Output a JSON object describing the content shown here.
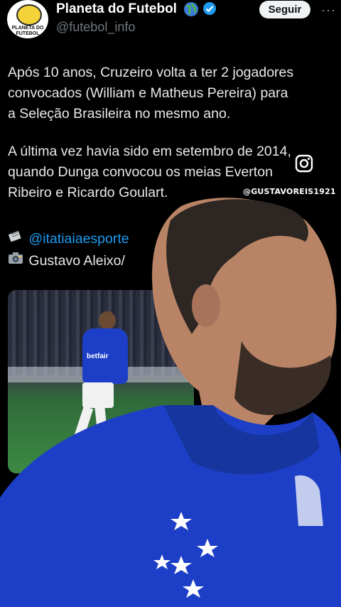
{
  "header": {
    "account_name": "Planeta do Futebol",
    "handle": "@futebol_info",
    "follow_label": "Seguir",
    "more_label": "···",
    "avatar_logo_text": "PLANETA DO FUTEBOL"
  },
  "tweet": {
    "paragraph1": "Após 10 anos, Cruzeiro volta a ter 2 jogadores\nconvocados (William e Matheus Pereira) para\na Seleção Brasileira no mesmo ano.",
    "paragraph2": "A última vez havia sido em setembro de 2014,\nquando Dunga convocou os meias Everton\nRibeiro e Ricardo Goulart.",
    "credit_mention": "@itatiaiaesporte",
    "photo_credit": "Gustavo Aleixo/"
  },
  "photo": {
    "sponsor_text": "betfair"
  },
  "overlay": {
    "watermark": "@GUSTAVOREIS1921"
  },
  "icons": [
    "globe-icon",
    "verified-icon",
    "more-icon",
    "newspaper-icon",
    "camera-icon",
    "instagram-icon"
  ],
  "colors": {
    "background": "#000000",
    "link": "#1d9bf0",
    "verified": "#1d9bf0",
    "jersey": "#1d3fc7"
  }
}
